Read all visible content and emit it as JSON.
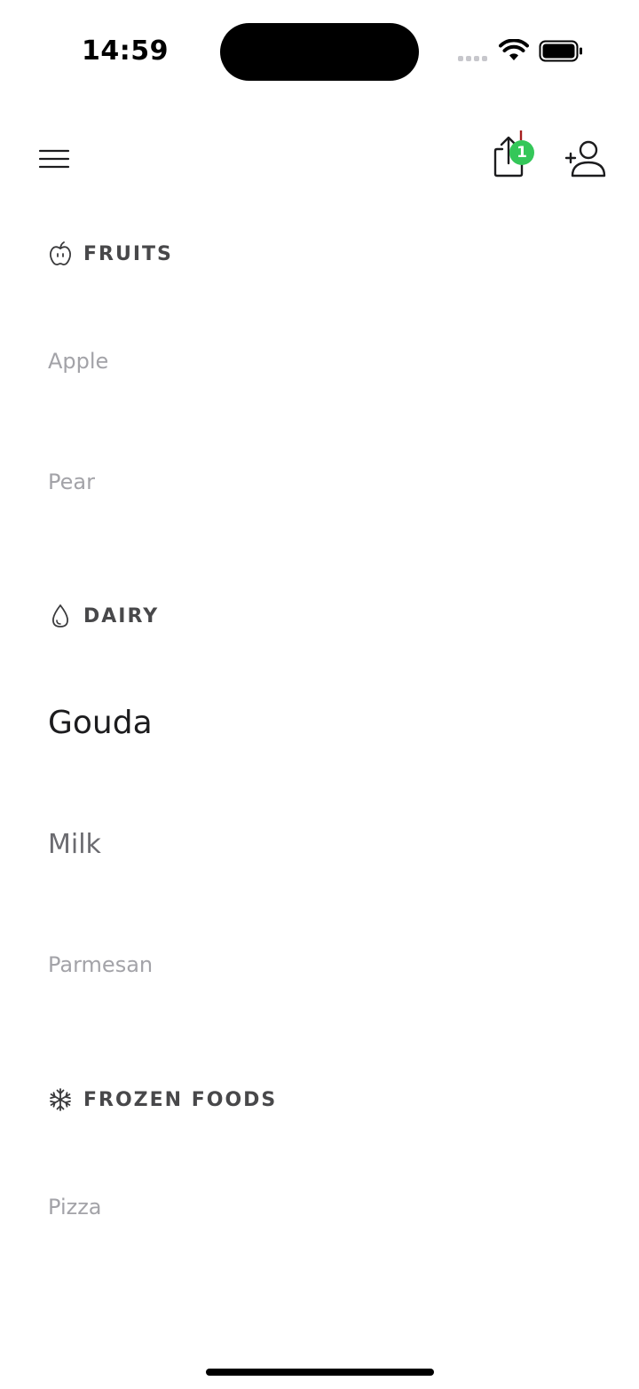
{
  "status_bar": {
    "time": "14:59"
  },
  "toolbar": {
    "share_badge_count": "1",
    "badge_color": "#34c759"
  },
  "sections": [
    {
      "title": "FRUITS",
      "icon": "apple-icon",
      "items": [
        "Apple",
        "Pear"
      ]
    },
    {
      "title": "DAIRY",
      "icon": "drop-icon",
      "items": [
        "Gouda",
        "Milk",
        "Parmesan"
      ]
    },
    {
      "title": "FROZEN FOODS",
      "icon": "snowflake-icon",
      "items": [
        "Pizza"
      ]
    }
  ]
}
